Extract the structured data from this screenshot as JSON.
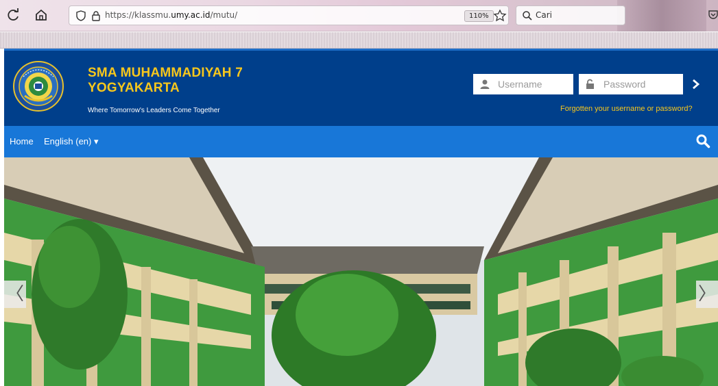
{
  "browser": {
    "url_prefix": "https://klassmu.",
    "url_domain": "umy.ac.id",
    "url_path": "/mutu/",
    "zoom": "110%",
    "search_placeholder": "Cari"
  },
  "site": {
    "title_line1": "SMA MUHAMMADIYAH 7",
    "title_line2": "YOGYAKARTA",
    "tagline": "Where Tomorrow's Leaders Come Together"
  },
  "login": {
    "username_placeholder": "Username",
    "password_placeholder": "Password",
    "forgot_link": "Forgotten your username or password?"
  },
  "nav": {
    "home": "Home",
    "language": "English (en) ▾"
  },
  "carousel": {
    "prev": "〈",
    "next": "〉"
  },
  "colors": {
    "header_bg": "#003f8b",
    "nav_bg": "#1877d8",
    "title_accent": "#f7c71c"
  }
}
